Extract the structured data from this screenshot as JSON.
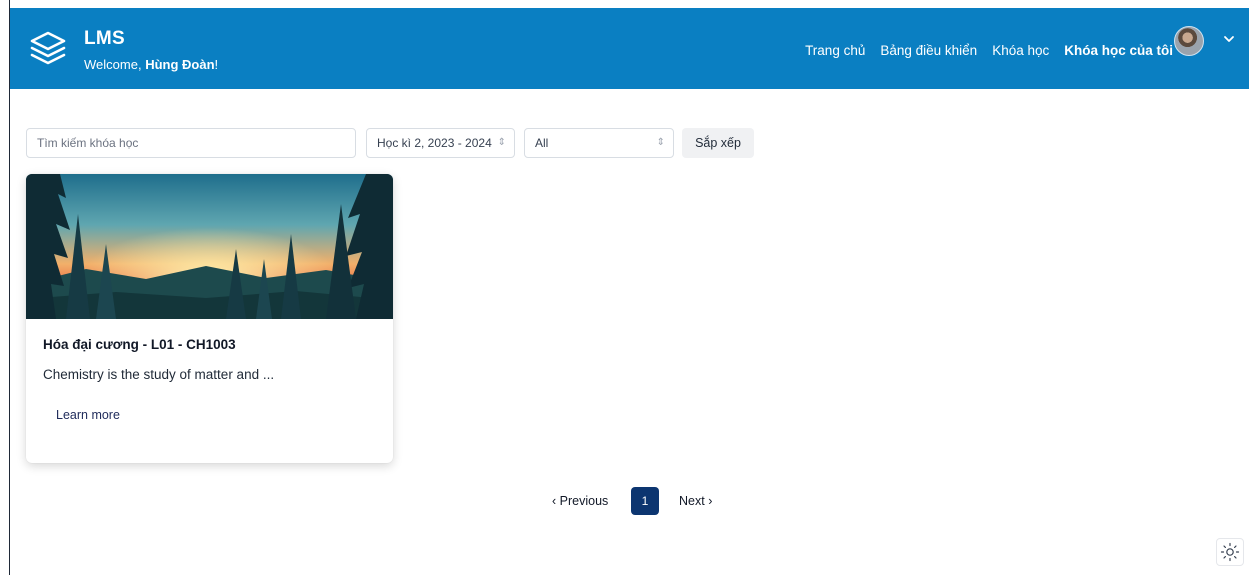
{
  "header": {
    "brand": "LMS",
    "welcome_prefix": "Welcome,",
    "user_name": "Hùng Đoàn",
    "welcome_suffix": "!",
    "nav": [
      "Trang chủ",
      "Bảng điều khiển",
      "Khóa học",
      "Khóa học của tôi"
    ],
    "active_nav": "Khóa học của tôi",
    "avatar_icon": "user-avatar",
    "menu_icon": "chevron-down-icon",
    "brand_color": "#0a7fc2"
  },
  "filters": {
    "search_placeholder": "Tìm kiếm khóa học",
    "semester_value": "Học kì 2, 2023 - 2024",
    "category_value": "All",
    "sort_label": "Sắp xếp"
  },
  "courses": [
    {
      "title": "Hóa đại cương - L01 - CH1003",
      "description": "Chemistry is the study of matter and ...",
      "link_label": "Learn more"
    }
  ],
  "pagination": {
    "previous_label": "Previous",
    "current_page": "1",
    "next_label": "Next",
    "accent_color": "#0c3570"
  },
  "theme_toggle_icon": "sun-icon"
}
